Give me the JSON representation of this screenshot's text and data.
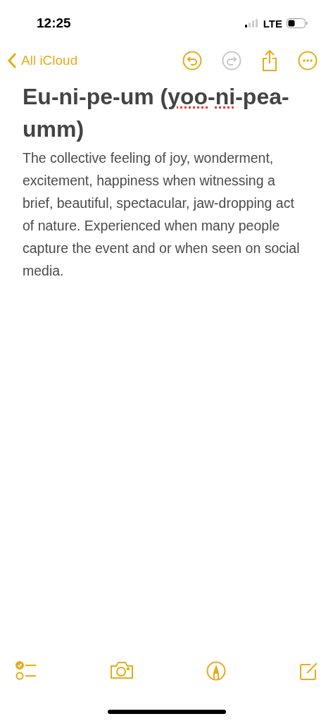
{
  "status_bar": {
    "time": "12:25",
    "network": "LTE"
  },
  "nav": {
    "back_label": "All iCloud",
    "actions": [
      {
        "kind": "undo",
        "disabled": false
      },
      {
        "kind": "redo",
        "disabled": true
      },
      {
        "kind": "share",
        "disabled": false
      },
      {
        "kind": "more",
        "disabled": false
      }
    ]
  },
  "note": {
    "title_parts": [
      {
        "text": "Eu-ni-pe-um (",
        "misspelled": false
      },
      {
        "text": "yoo",
        "misspelled": true
      },
      {
        "text": "-",
        "misspelled": false
      },
      {
        "text": "ni",
        "misspelled": true
      },
      {
        "text": "-pea-umm)",
        "misspelled": false
      }
    ],
    "body": "The collective feeling of joy, wonderment, excitement, happiness when witnessing a brief, beautiful, spectacular, jaw-dropping act of nature. Experienced when many people capture the event and or when seen on social media."
  },
  "toolbar": [
    {
      "kind": "checklist"
    },
    {
      "kind": "camera"
    },
    {
      "kind": "markup"
    },
    {
      "kind": "compose"
    }
  ]
}
